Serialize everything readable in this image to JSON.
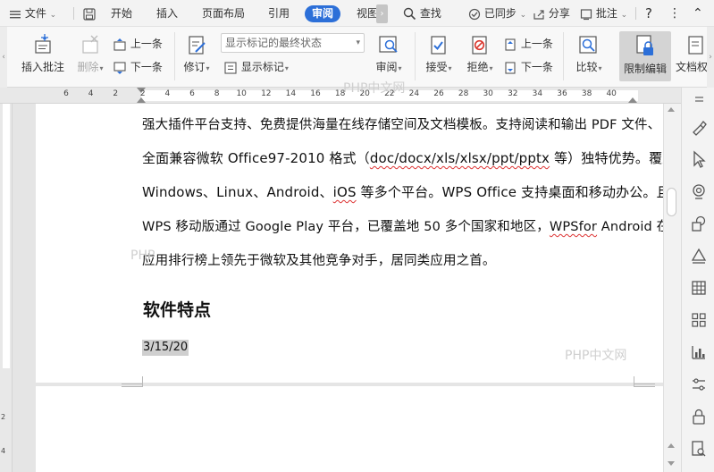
{
  "menubar": {
    "file_label": "文件",
    "tabs": [
      "开始",
      "插入",
      "页面布局",
      "引用",
      "审阅",
      "视图"
    ],
    "active_tab": "审阅",
    "search_label": "查找",
    "sync_label": "已同步",
    "share_label": "分享",
    "comment_label": "批注",
    "help_label": "?"
  },
  "ribbon": {
    "insert_comment": "插入批注",
    "delete": "删除",
    "prev_comment": "上一条",
    "next_comment": "下一条",
    "revise": "修订",
    "show_markup_select": "显示标记的最终状态",
    "show_markup": "显示标记",
    "review": "审阅",
    "accept": "接受",
    "reject": "拒绝",
    "prev_change": "上一条",
    "next_change": "下一条",
    "compare": "比较",
    "restrict_edit": "限制编辑",
    "doc_permission": "文档权"
  },
  "ruler": {
    "numbers": [
      "6",
      "4",
      "2",
      "2",
      "4",
      "6",
      "8",
      "10",
      "12",
      "14",
      "16",
      "18",
      "20",
      "22",
      "24",
      "26",
      "28",
      "30",
      "32",
      "34",
      "36",
      "38",
      "40"
    ],
    "vertical_numbers": [
      "2",
      "4"
    ]
  },
  "document": {
    "lines": [
      "强大插件平台支持、免费提供海量在线存储空间及文档模板。支持阅读和输出 PDF 文件、",
      "全面兼容微软 Office97-2010 格式（doc/docx/xls/xlsx/ppt/pptx 等）独特优势。覆盖",
      "Windows、Linux、Android、iOS 等多个平台。WPS Office 支持桌面和移动办公。且",
      "WPS 移动版通过 Google Play 平台，已覆盖地 50 多个国家和地区，WPSfor Android 在",
      "应用排行榜上领先于微软及其他竞争对手，居同类应用之首。"
    ],
    "line2_parts": [
      "全面兼容微软 Office97-2010 格式（",
      "doc/docx/xls/xlsx/ppt/pptx",
      " 等）独特优势。覆盖"
    ],
    "line3_parts": [
      "Windows、Linux、Android、",
      "iOS",
      " 等多个平台。WPS Office 支持桌面和移动办公。且"
    ],
    "line4_parts": [
      "WPS 移动版通过 Google Play 平台，已覆盖地 50 多个国家和地区，",
      "WPSfor",
      " Android 在"
    ],
    "heading": "软件特点",
    "date": "3/15/20"
  },
  "watermarks": {
    "top": "PHP中文网",
    "bottom": "PHP中文网",
    "left": "PHP"
  },
  "colors": {
    "accent": "#2c6fd8",
    "restrict_bg": "#d4d4d4"
  }
}
